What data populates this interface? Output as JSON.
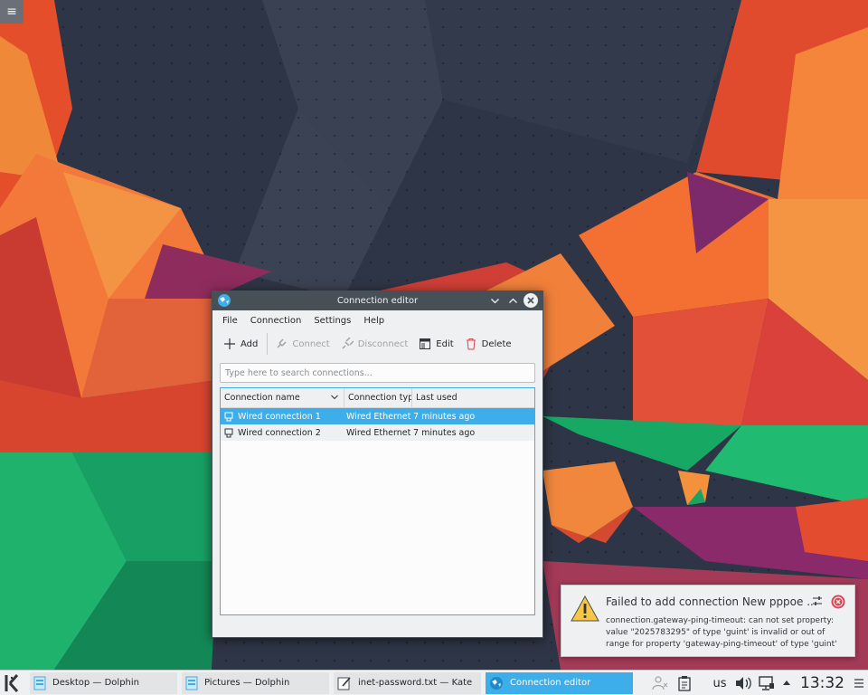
{
  "desktop": {
    "toolbox_glyph": "≡"
  },
  "window": {
    "title": "Connection editor",
    "menu": [
      "File",
      "Connection",
      "Settings",
      "Help"
    ],
    "toolbar": {
      "add": "Add",
      "connect": "Connect",
      "disconnect": "Disconnect",
      "edit": "Edit",
      "delete": "Delete"
    },
    "search": {
      "placeholder": "Type here to search connections...",
      "value": ""
    },
    "list": {
      "columns": [
        "Connection name",
        "Connection typ",
        "Last used"
      ],
      "rows": [
        {
          "name": "Wired connection 1",
          "type": "Wired Ethernet",
          "last_used": "7 minutes ago",
          "selected": true
        },
        {
          "name": "Wired connection 2",
          "type": "Wired Ethernet",
          "last_used": "7 minutes ago",
          "selected": false
        }
      ]
    }
  },
  "notification": {
    "title": "Failed to add connection New pppoe ...",
    "body": "connection.gateway-ping-timeout: can not set property: value \"2025783295\" of type 'guint' is invalid or out of range for property 'gateway-ping-timeout' of type 'guint'",
    "icon": "warning-icon"
  },
  "taskbar": {
    "tasks": [
      {
        "label": "Desktop — Dolphin",
        "icon": "folder-icon",
        "active": false
      },
      {
        "label": "Pictures — Dolphin",
        "icon": "folder-icon",
        "active": false
      },
      {
        "label": "inet-password.txt  — Kate",
        "icon": "text-editor-icon",
        "active": false
      },
      {
        "label": "Connection editor",
        "icon": "network-globe-icon",
        "active": true
      }
    ],
    "keyboard_layout": "us",
    "clock": "13:32"
  },
  "colors": {
    "accent": "#3daee9",
    "titlebar": "#475057",
    "window_bg": "#eff0f1",
    "error_red": "#da4453",
    "warning_yellow": "#f6c744"
  }
}
